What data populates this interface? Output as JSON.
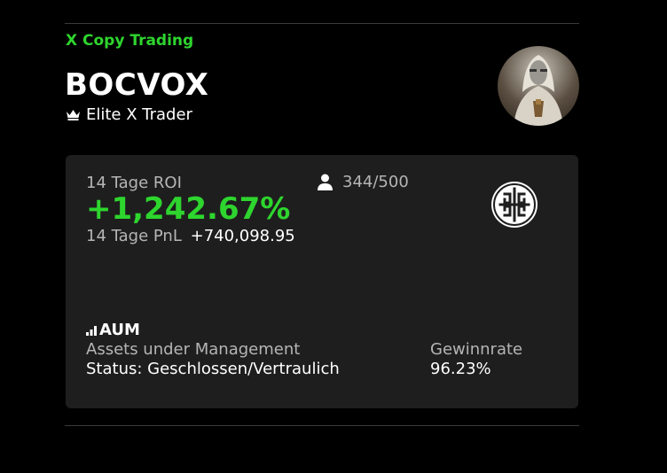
{
  "header": {
    "brand": "X Copy Trading",
    "trader_name": "BOCVOX",
    "trader_rank": "Elite X Trader"
  },
  "card": {
    "roi_label": "14 Tage ROI",
    "roi_value": "+1,242.67%",
    "pnl_label": "14 Tage PnL",
    "pnl_value": "+740,098.95",
    "followers": "344/500",
    "aum_title": "AUM",
    "aum_subtitle": "Assets under Management",
    "aum_status": "Status: Geschlossen/Vertraulich",
    "winrate_label": "Gewinnrate",
    "winrate_value": "96.23%"
  },
  "colors": {
    "accent_green": "#2ed52e",
    "card_bg": "#1e1e1e",
    "page_bg": "#000000"
  },
  "icons": [
    "crown-icon",
    "person-icon",
    "brand-logo-icon",
    "signal-bars-icon"
  ]
}
